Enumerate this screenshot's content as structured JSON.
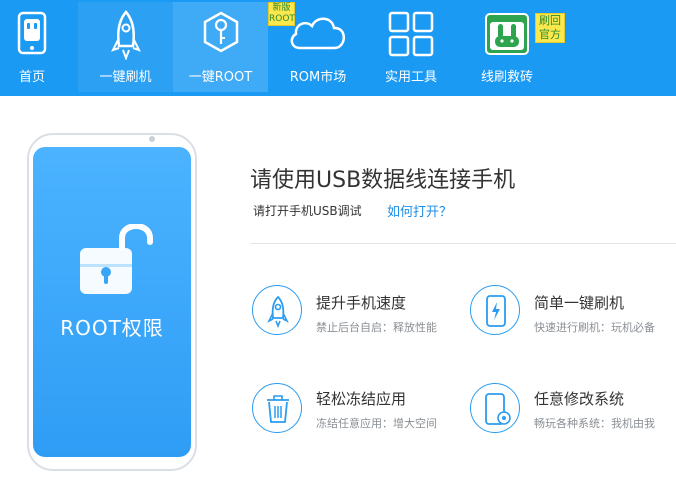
{
  "nav": {
    "items": [
      {
        "label": "首页",
        "icon": "phone-rabbit-icon"
      },
      {
        "label": "一键刷机",
        "icon": "rocket-icon"
      },
      {
        "label": "一键ROOT",
        "icon": "key-hexagon-icon"
      },
      {
        "label": "ROM市场",
        "icon": "cloud-icon"
      },
      {
        "label": "实用工具",
        "icon": "grid-icon"
      },
      {
        "label": "线刷救砖",
        "icon": "rabbit-box-icon"
      }
    ],
    "active_index": 2,
    "badge_new": [
      "新版",
      "ROOT"
    ],
    "badge_brush": [
      "刷回",
      "官方"
    ]
  },
  "phone": {
    "screen_text": "ROOT权限"
  },
  "main": {
    "title": "请使用USB数据线连接手机",
    "subtitle": "请打开手机USB调试",
    "help_link": "如何打开？",
    "features": [
      {
        "title": "提升手机速度",
        "desc": "禁止后台自启：释放性能",
        "icon": "rocket-icon"
      },
      {
        "title": "简单一键刷机",
        "desc": "快速进行刷机：玩机必备",
        "icon": "phone-bolt-icon"
      },
      {
        "title": "轻松冻结应用",
        "desc": "冻结任意应用：增大空间",
        "icon": "trash-icon"
      },
      {
        "title": "任意修改系统",
        "desc": "畅玩各种系统：我机由我",
        "icon": "phone-gear-icon"
      }
    ]
  },
  "colors": {
    "nav_bg": "#1b9af4",
    "accent": "#1b8ee8",
    "badge_bg": "#fbe84c"
  }
}
